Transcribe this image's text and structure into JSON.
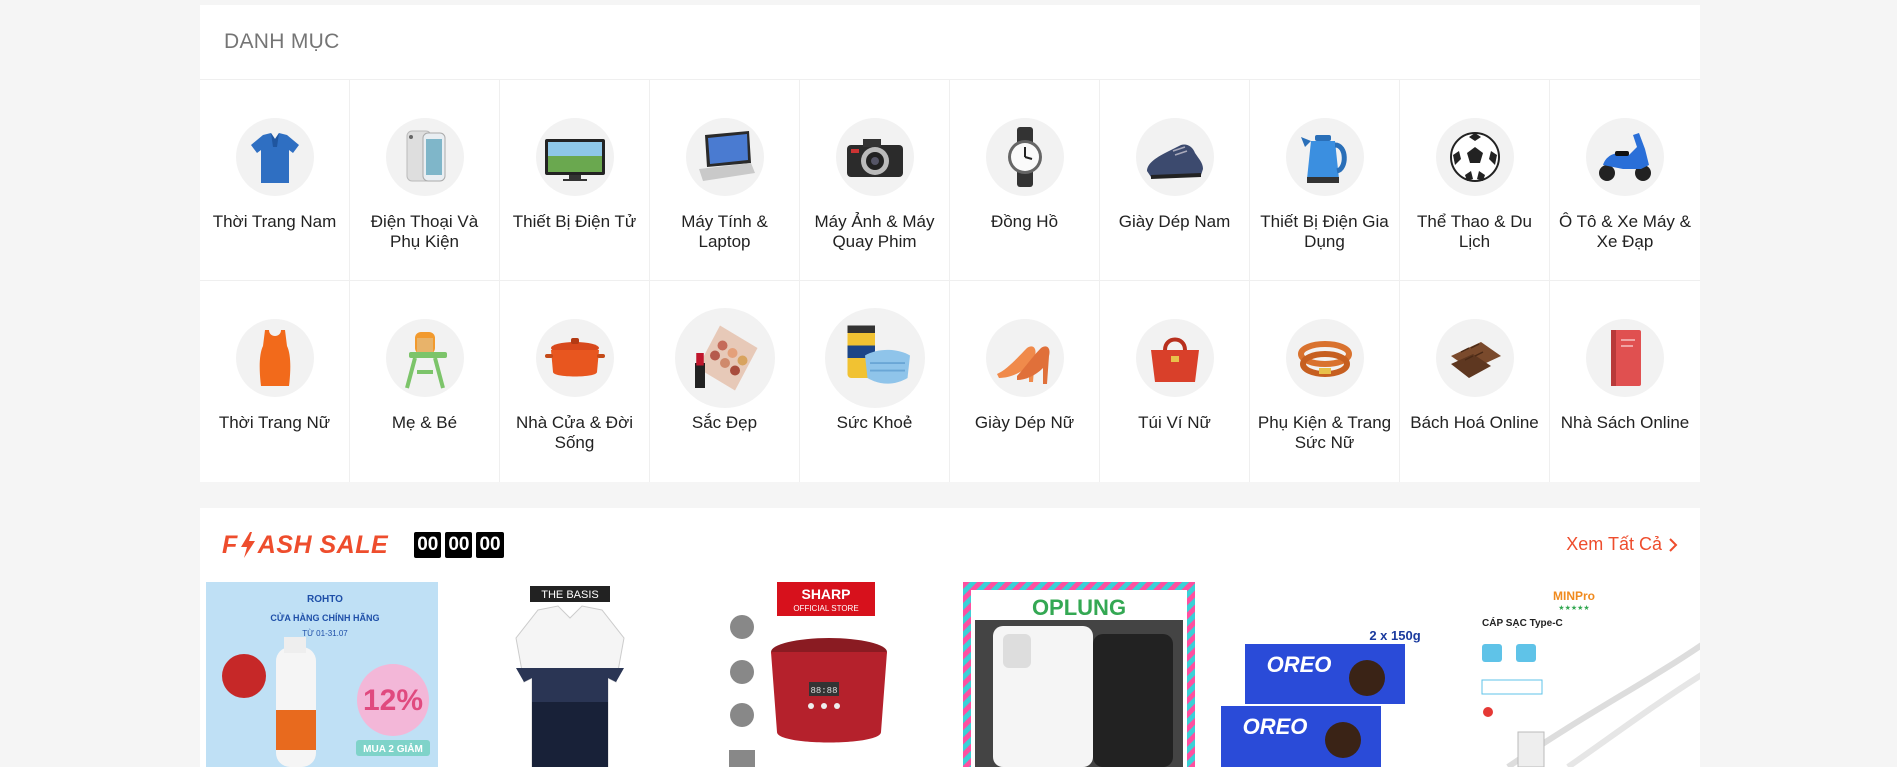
{
  "category": {
    "title": "DANH MỤC",
    "items": [
      {
        "label": "Thời Trang Nam",
        "icon": "polo-shirt-icon"
      },
      {
        "label": "Điện Thoại Và Phụ Kiện",
        "icon": "smartphone-icon"
      },
      {
        "label": "Thiết Bị Điện Tử",
        "icon": "television-icon"
      },
      {
        "label": "Máy Tính & Laptop",
        "icon": "laptop-icon"
      },
      {
        "label": "Máy Ảnh & Máy Quay Phim",
        "icon": "camera-icon"
      },
      {
        "label": "Đồng Hồ",
        "icon": "watch-icon"
      },
      {
        "label": "Giày Dép Nam",
        "icon": "mens-shoe-icon"
      },
      {
        "label": "Thiết Bị Điện Gia Dụng",
        "icon": "kettle-icon"
      },
      {
        "label": "Thể Thao & Du Lịch",
        "icon": "soccer-ball-icon"
      },
      {
        "label": "Ô Tô & Xe Máy & Xe Đạp",
        "icon": "scooter-icon"
      },
      {
        "label": "Thời Trang Nữ",
        "icon": "tank-top-icon"
      },
      {
        "label": "Mẹ & Bé",
        "icon": "high-chair-icon"
      },
      {
        "label": "Nhà Cửa & Đời Sống",
        "icon": "cooking-pot-icon"
      },
      {
        "label": "Sắc Đẹp",
        "icon": "makeup-palette-icon"
      },
      {
        "label": "Sức Khoẻ",
        "icon": "face-mask-icon"
      },
      {
        "label": "Giày Dép Nữ",
        "icon": "high-heel-icon"
      },
      {
        "label": "Túi Ví Nữ",
        "icon": "handbag-icon"
      },
      {
        "label": "Phụ Kiện & Trang Sức Nữ",
        "icon": "bracelet-icon"
      },
      {
        "label": "Bách Hoá Online",
        "icon": "chocolate-icon"
      },
      {
        "label": "Nhà Sách Online",
        "icon": "book-icon"
      }
    ]
  },
  "flash_sale": {
    "title_left": "F",
    "title_right": "ASH SALE",
    "timer": [
      "00",
      "00",
      "00"
    ],
    "see_all": "Xem Tất Cả",
    "products": [
      {
        "name": "selsun-shampoo-product",
        "brand": "ROHTO",
        "caption": "CỬA HÀNG CHÍNH HÃNG",
        "badge": "12%",
        "date": "TỪ 01-31.07",
        "sub": "MUA 2 GIẢM"
      },
      {
        "name": "polo-shirt-product",
        "brand": "THE BASIS"
      },
      {
        "name": "rice-cooker-product",
        "brand": "SHARP",
        "caption": "OFFICIAL STORE",
        "display": "88:88"
      },
      {
        "name": "phone-case-product",
        "brand": "OPLUNG"
      },
      {
        "name": "oreo-product",
        "brand": "OREO",
        "caption": "2 x 150g"
      },
      {
        "name": "charging-cable-product",
        "brand": "MINPro",
        "caption": "CÁP SẠC Type-C",
        "stars": "★★★★★"
      }
    ]
  },
  "colors": {
    "accent": "#ee4d2d",
    "background": "#f5f5f5",
    "panel": "#ffffff"
  }
}
